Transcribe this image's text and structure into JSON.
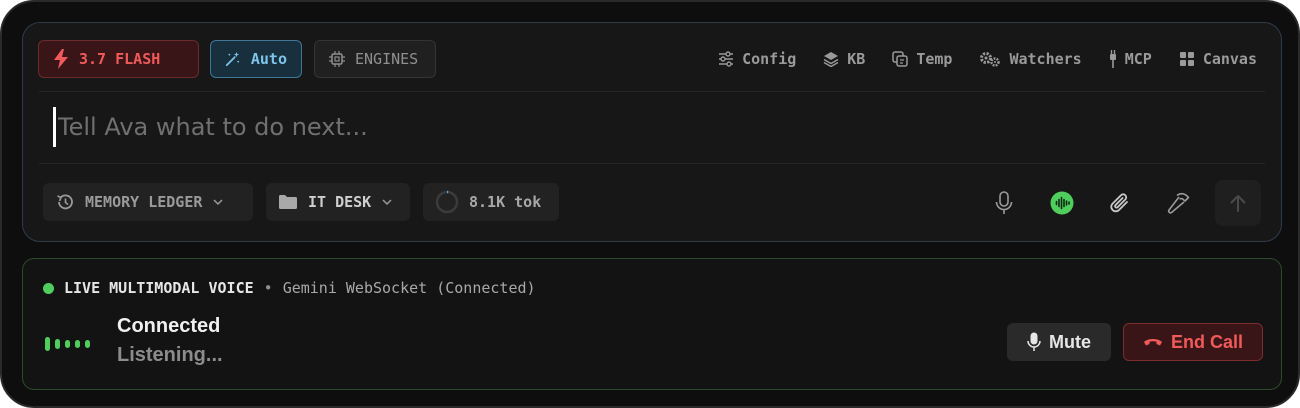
{
  "composer": {
    "model_pill": "3.7 FLASH",
    "mode_pill": "Auto",
    "engines_pill": "ENGINES",
    "nav": [
      {
        "label": "Config",
        "icon": "sliders-icon"
      },
      {
        "label": "KB",
        "icon": "layers-icon"
      },
      {
        "label": "Temp",
        "icon": "copy-icon"
      },
      {
        "label": "Watchers",
        "icon": "gears-icon"
      },
      {
        "label": "MCP",
        "icon": "plug-icon"
      },
      {
        "label": "Canvas",
        "icon": "grid-icon"
      }
    ],
    "input_placeholder": "Tell Ava what to do next...",
    "input_value": "",
    "chips": {
      "memory": "MEMORY LEDGER",
      "folder": "IT DESK",
      "tokens": "8.1K tok"
    },
    "tools": [
      "microphone-icon",
      "voice-wave-icon",
      "paperclip-icon",
      "hammer-icon",
      "send-arrow-icon"
    ],
    "colors": {
      "accent_red": "#ef5a5a",
      "accent_blue": "#7ec4ea",
      "accent_green": "#4fce5d"
    }
  },
  "voice": {
    "title": "LIVE MULTIMODAL VOICE",
    "separator": "•",
    "status": "Gemini WebSocket (Connected)",
    "state": "Connected",
    "substate": "Listening...",
    "mute_label": "Mute",
    "end_label": "End Call"
  }
}
